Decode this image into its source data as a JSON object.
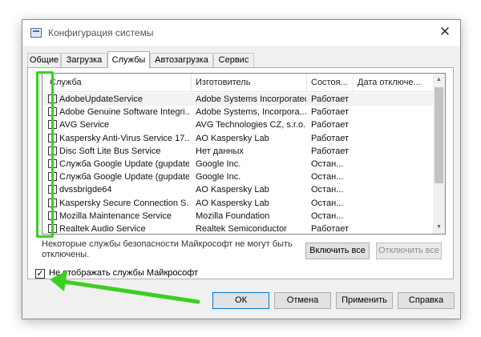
{
  "window": {
    "title": "Конфигурация системы",
    "close_glyph": "✕"
  },
  "tabs": [
    {
      "label": "Общие",
      "active": false
    },
    {
      "label": "Загрузка",
      "active": false
    },
    {
      "label": "Службы",
      "active": true
    },
    {
      "label": "Автозагрузка",
      "active": false
    },
    {
      "label": "Сервис",
      "active": false
    }
  ],
  "columns": {
    "service": "Служба",
    "manufacturer": "Изготовитель",
    "status": "Состоя...",
    "date": "Дата отключе..."
  },
  "services": [
    {
      "name": "AdobeUpdateService",
      "manufacturer": "Adobe Systems Incorporated",
      "status": "Работает",
      "checked": false
    },
    {
      "name": "Adobe Genuine Software Integri...",
      "manufacturer": "Adobe Systems, Incorpora...",
      "status": "Работает",
      "checked": false
    },
    {
      "name": "AVG Service",
      "manufacturer": "AVG Technologies CZ, s.r.o.",
      "status": "Работает",
      "checked": false
    },
    {
      "name": "Kaspersky Anti-Virus Service 17....",
      "manufacturer": "AO Kaspersky Lab",
      "status": "Работает",
      "checked": false
    },
    {
      "name": "Disc Soft Lite Bus Service",
      "manufacturer": "Нет данных",
      "status": "Работает",
      "checked": false
    },
    {
      "name": "Служба Google Update (gupdate)",
      "manufacturer": "Google Inc.",
      "status": "Остан...",
      "checked": false
    },
    {
      "name": "Служба Google Update (gupdate...",
      "manufacturer": "Google Inc.",
      "status": "Остан...",
      "checked": false
    },
    {
      "name": "dvssbrigde64",
      "manufacturer": "AO Kaspersky Lab",
      "status": "Остан...",
      "checked": false
    },
    {
      "name": "Kaspersky Secure Connection S...",
      "manufacturer": "AO Kaspersky Lab",
      "status": "Остан...",
      "checked": false
    },
    {
      "name": "Mozilla Maintenance Service",
      "manufacturer": "Mozilla Foundation",
      "status": "Остан...",
      "checked": false
    },
    {
      "name": "Realtek Audio Service",
      "manufacturer": "Realtek Semiconductor",
      "status": "Работает",
      "checked": false
    }
  ],
  "note": "Некоторые службы безопасности Майкрософт не могут быть отключены.",
  "buttons": {
    "enable_all": "Включить все",
    "disable_all": "Отключить все",
    "ok": "ОК",
    "cancel": "Отмена",
    "apply": "Применить",
    "help": "Справка"
  },
  "hide_microsoft": {
    "label": "Не отображать службы Майкрософт",
    "checked": true,
    "check_glyph": "✓"
  },
  "annotation": {
    "color": "#3bd021"
  }
}
